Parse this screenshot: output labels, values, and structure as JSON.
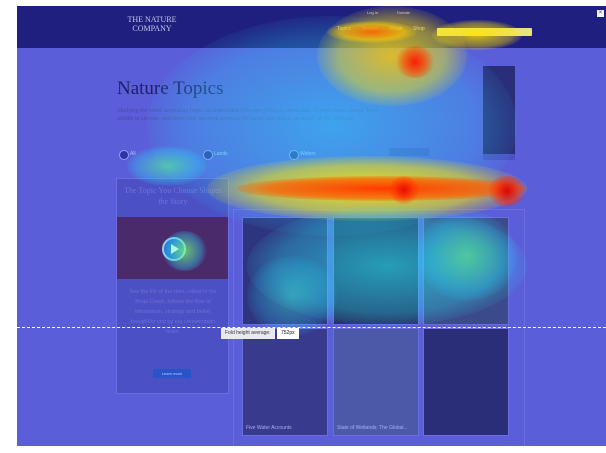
{
  "header": {
    "logo_text": "THE NATURE\nCOMPANY",
    "nav": [
      "Topics",
      "Stories",
      "About",
      "Shop"
    ],
    "utility": [
      "Log In",
      "Donate"
    ]
  },
  "main": {
    "title": "Nature Topics",
    "intro": "Studying the world around us helps us understand how everything is connected. Explore topics below, from wildlife to climate, and learn how our work protects the lands and waters on which all life depends.",
    "filters": [
      "All",
      "Lands",
      "Waters"
    ],
    "sidebar_card": {
      "title": "The Topic You Choose Shapes the Story",
      "text": "See the life of the river, called in the Bruja Creek, follows the flow of information, strategy and belief, brought to you by our conservation team.",
      "button": "Learn more"
    },
    "tiles": [
      {
        "caption": ""
      },
      {
        "caption": ""
      },
      {
        "caption": ""
      },
      {
        "caption": "Five Water Accounts"
      },
      {
        "caption": "State of Wetlands: The Global..."
      },
      {
        "caption": ""
      }
    ]
  },
  "fold": {
    "label": "Fold height average:",
    "value": "752px"
  },
  "colors": {
    "overlay_base": "#3b3fb5",
    "hot": "#ff2a00",
    "warm": "#ffe600",
    "cool": "#22d4ff"
  }
}
